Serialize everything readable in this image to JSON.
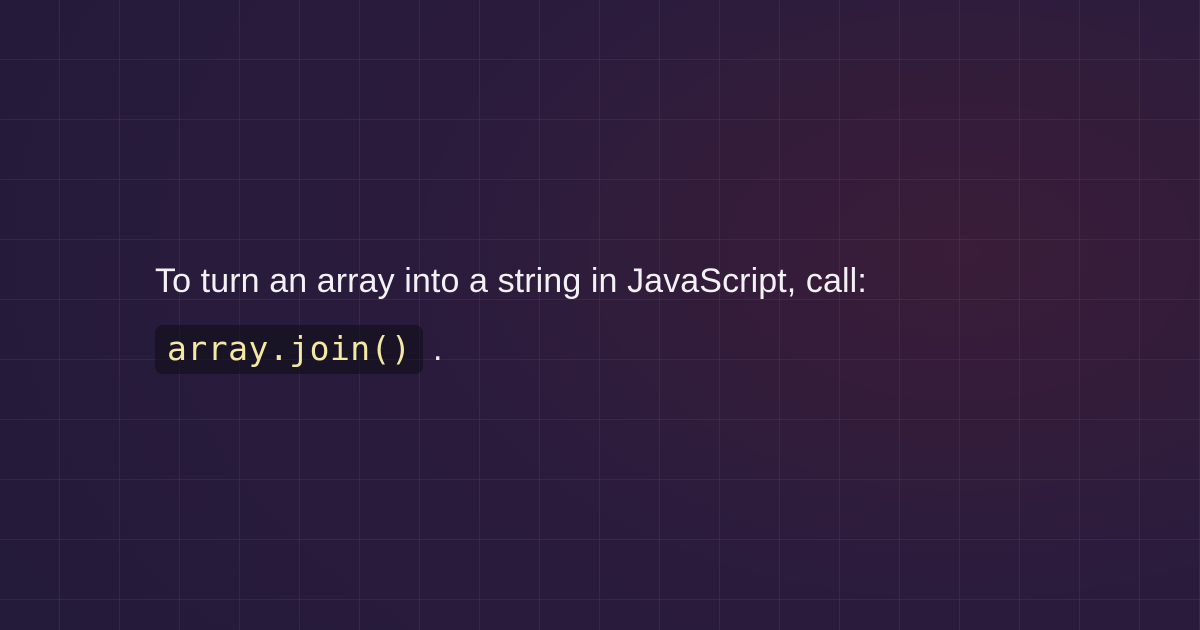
{
  "sentence": {
    "part1": "To turn an array into a string in JavaScript, call: ",
    "code": "array.join()",
    "part2": " ."
  }
}
